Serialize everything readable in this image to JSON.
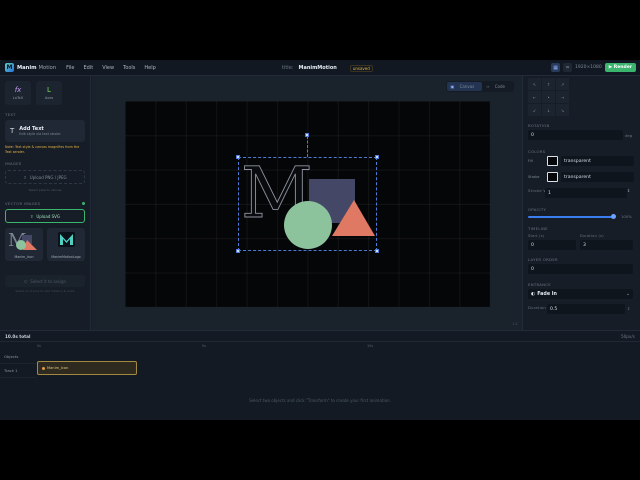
{
  "menubar": {
    "logo_letter": "M",
    "brand": "Manim",
    "brand_sub": "Motion",
    "menu": [
      "File",
      "Edit",
      "View",
      "Tools",
      "Help"
    ],
    "title_label": "title:",
    "title_value": "ManimMotion",
    "status_badge": "unsaved",
    "resolution": "1920×1080",
    "render_label": "Render"
  },
  "left": {
    "tiles": [
      {
        "icon": "fx",
        "label": "LaTeX"
      },
      {
        "icon": "L",
        "label": "Axes"
      }
    ],
    "text_section": "TEXT",
    "add_text_title": "Add Text",
    "add_text_sub": "Edit style via text stroke",
    "note": "Note: Text style & canvas magnifies from the Text sender.",
    "images_section": "IMAGES",
    "upload_image_label": "Upload PNG / JPEG",
    "upload_image_hint": "Select pixel to canvas",
    "vector_section": "VECTOR IMAGES",
    "upload_svg_label": "Upload SVG",
    "thumbs": [
      {
        "caption": "Manim_Icon"
      },
      {
        "caption": "ManimMotionLogo"
      }
    ],
    "select_hint": "Select it to assign",
    "select_sub": "Select on tracks to add rotation & scale"
  },
  "canvas": {
    "view_tabs": [
      "Canvas",
      "Code"
    ],
    "active_tab": "Canvas",
    "zoom_indicator": "1:1",
    "artwork_letter": "M",
    "colors": {
      "square": "#444766",
      "circle": "#8cc39d",
      "triangle": "#e07963"
    }
  },
  "right": {
    "align_buttons": [
      "↖",
      "↑",
      "↗",
      "←",
      "•",
      "→",
      "↙",
      "↓",
      "↘"
    ],
    "rotation_label": "ROTATION",
    "rotation_value": "0",
    "rotation_unit": "deg",
    "colors_label": "COLORS",
    "fill_label": "Fill",
    "fill_value": "transparent",
    "stroke_label": "Stroke",
    "stroke_value": "transparent",
    "stroke_width_label": "Stroke W",
    "stroke_width_value": "1",
    "opacity_label": "OPACITY",
    "opacity_value": "100%",
    "opacity_level": 1.0,
    "timeline_label": "TIMELINE",
    "start_label": "Start (s)",
    "start_value": "0",
    "duration_label": "Duration (s)",
    "duration_value": "3",
    "layer_label": "LAYER ORDER",
    "layer_value": "0",
    "entrance_label": "ENTRANCE",
    "entrance_value": "Fade In",
    "entrance_duration_label": "Duration",
    "entrance_duration_value": "0.5"
  },
  "timeline": {
    "total": "10.0s total",
    "zoom": "50px/s",
    "ticks": [
      "0s",
      "5s",
      "10s"
    ],
    "rows": [
      "Objects",
      "Track 1"
    ],
    "clip_label": "Manim_Icon",
    "hint": "Select two objects and click \"Transform\" to create your first animation."
  }
}
